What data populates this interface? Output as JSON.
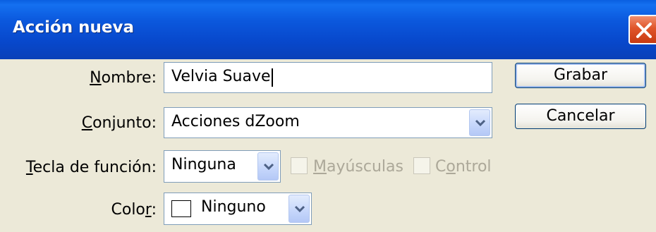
{
  "window": {
    "title": "Acción nueva"
  },
  "form": {
    "name": {
      "label_ak": "N",
      "label_rest": "ombre:",
      "value": "Velvia Suave"
    },
    "set": {
      "label_ak": "C",
      "label_rest": "onjunto:",
      "value": "Acciones dZoom"
    },
    "function_key": {
      "label_ak": "T",
      "label_rest": "ecla de función:",
      "value": "Ninguna",
      "shift": {
        "label_ak": "M",
        "label_rest": "ayúsculas",
        "checked": false
      },
      "control": {
        "label_pre": "C",
        "label_ak": "o",
        "label_rest": "ntrol",
        "checked": false
      }
    },
    "color": {
      "label_pre": "Colo",
      "label_ak": "r",
      "label_post": ":",
      "value": "Ninguno",
      "swatch": "#ffffff"
    }
  },
  "buttons": {
    "record": "Grabar",
    "cancel": "Cancelar"
  },
  "colors": {
    "titlebar": "#0a56d8",
    "close": "#e0552a",
    "face": "#ece9d8",
    "field_border": "#7f9db9",
    "disabled_text": "#aca899"
  }
}
